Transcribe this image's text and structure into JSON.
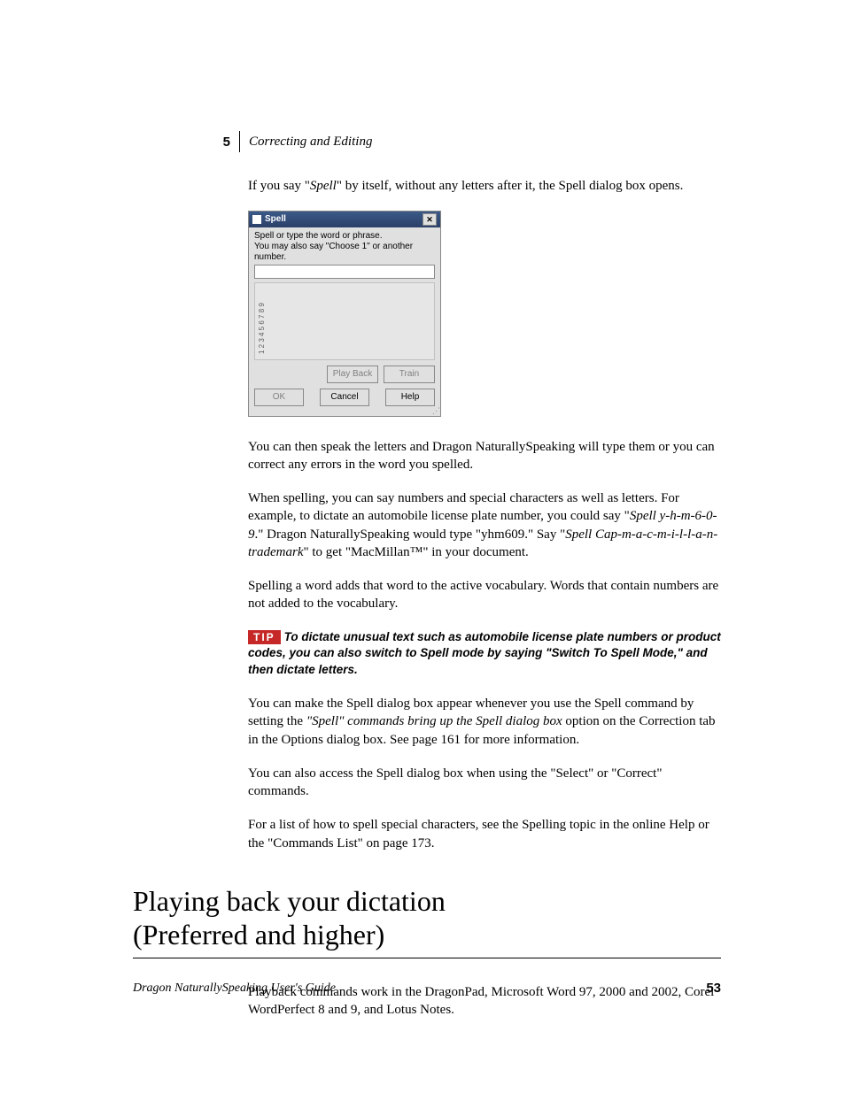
{
  "header": {
    "chapter_number": "5",
    "chapter_title": "Correcting and Editing"
  },
  "dialog": {
    "title": "Spell",
    "instr1": "Spell or type the word or phrase.",
    "instr2": "You may also say \"Choose 1\" or another number.",
    "list_numbers": "1 2 3 4 5 6 7 8 9",
    "btn_playback": "Play Back",
    "btn_train": "Train",
    "btn_ok": "OK",
    "btn_cancel": "Cancel",
    "btn_help": "Help",
    "close": "✕"
  },
  "paras": {
    "p1_a": "If you say \"",
    "p1_b": "Spell",
    "p1_c": "\" by itself, without any letters after it, the Spell dialog box opens.",
    "p2": "You can then speak the letters and Dragon NaturallySpeaking will type them or you can correct any errors in the word you spelled.",
    "p3_a": "When spelling, you can say numbers and special characters as well as letters. For example, to dictate an automobile license plate number, you could say \"",
    "p3_b": "Spell y-h-m-6-0-9",
    "p3_c": ".\" Dragon NaturallySpeaking would type \"yhm609.\" Say \"",
    "p3_d": "Spell Cap-m-a-c-m-i-l-l-a-n-trademark",
    "p3_e": "\" to get \"MacMillan™\" in your document.",
    "p4": "Spelling a word adds that word to the active vocabulary. Words that contain numbers are not added to the vocabulary.",
    "tip_label": "TIP",
    "tip": "To dictate unusual text such as automobile license plate numbers or product codes, you can also switch to Spell mode by saying \"Switch To Spell Mode,\" and then dictate letters.",
    "p5_a": "You can make the Spell dialog box appear whenever you use the Spell command by setting the ",
    "p5_b": "\"Spell\" commands bring up the Spell dialog box",
    "p5_c": " option on the Correction tab in the Options dialog box. See page 161 for more information.",
    "p6": "You can also access the Spell dialog box when using the \"Select\" or \"Correct\" commands.",
    "p7": "For a list of how to spell special characters, see the Spelling topic in the online Help or the \"Commands List\" on page 173."
  },
  "heading": {
    "line1": "Playing back your dictation",
    "line2": "(Preferred and higher)"
  },
  "after_heading": {
    "p1": "Playback commands work in the DragonPad, Microsoft Word 97, 2000 and 2002, Corel WordPerfect 8 and 9, and Lotus Notes."
  },
  "footer": {
    "left": "Dragon NaturallySpeaking User's Guide",
    "right": "53"
  }
}
